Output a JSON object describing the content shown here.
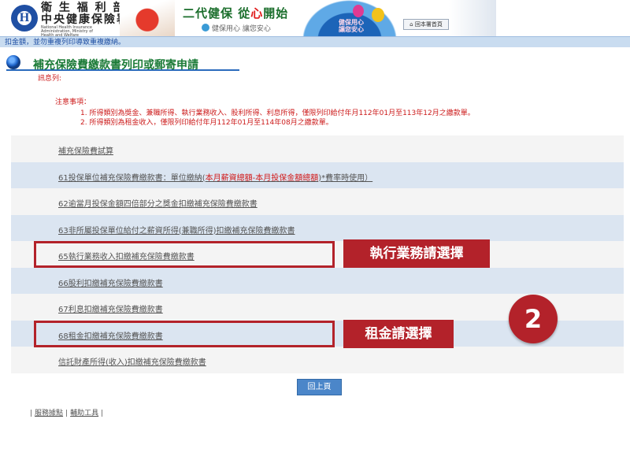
{
  "header": {
    "logo_char": "H",
    "org_name_line1": "衛 生 福 利 部",
    "org_name_line2": "中央健康保險署",
    "org_name_en": "National Health Insurance Administration, Ministry of Health and Welfare",
    "slogan_main_a": "二代健保 從",
    "slogan_main_heart": "心",
    "slogan_main_b": "開始",
    "slogan_sub": "健保用心 讓您安心",
    "globe_text_1": "健保用心",
    "globe_text_2": "讓您安心",
    "home_button": "回本署首頁"
  },
  "marquee": "扣金額，並勿重複列印導致重複繳納。",
  "page_title": "補充保險費繳款書列印或郵寄申請",
  "message_label": "訊息列:",
  "notice": {
    "title": "注意事項：",
    "lines": [
      "1. 所得類別為獎金、兼職所得、執行業務收入、股利所得、利息所得，僅限列印給付年月112年01月至113年12月之繳款單。",
      "2. 所得類別為租金收入，僅限列印給付年月112年01月至114年08月之繳款單。"
    ]
  },
  "links": [
    {
      "label": "補充保險費試算"
    },
    {
      "label_a": "61投保單位補充保險費繳款書：單位繳納(",
      "label_hl": "本月薪資總額-本月投保金額總額",
      "label_b": ")*費率時使用）"
    },
    {
      "label": "62逾當月投保金額四倍部分之獎金扣繳補充保險費繳款書"
    },
    {
      "label": "63非所屬投保單位給付之薪資所得(兼職所得)扣繳補充保險費繳款書"
    },
    {
      "label": "65執行業務收入扣繳補充保險費繳款書"
    },
    {
      "label": "66股利扣繳補充保險費繳款書"
    },
    {
      "label": "67利息扣繳補充保險費繳款書"
    },
    {
      "label": "68租金扣繳補充保險費繳款書"
    },
    {
      "label": "信託財產所得(收入)扣繳補充保險費繳款書"
    }
  ],
  "annotations": {
    "tag_business": "執行業務請選擇",
    "tag_rent": "租金請選擇",
    "step_number": "2"
  },
  "back_button": "回上頁",
  "footer": {
    "link1": "服務據點",
    "link2": "輔助工具"
  },
  "colors": {
    "accent_red": "#b3222a",
    "title_green": "#1a7a36",
    "row_blue": "#dbe5f1",
    "button_blue": "#4b86c9"
  }
}
